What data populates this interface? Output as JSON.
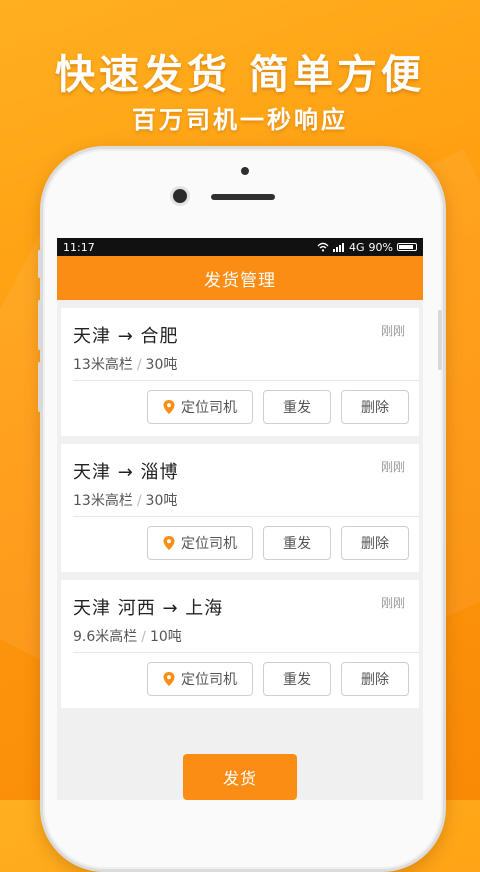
{
  "promo": {
    "headline": "快速发货 简单方便",
    "subline": "百万司机一秒响应"
  },
  "status_bar": {
    "time": "11:17",
    "network": "4G",
    "battery": "90%"
  },
  "app_bar": {
    "title": "发货管理"
  },
  "shipments": [
    {
      "route": "天津 → 合肥",
      "time": "刚刚",
      "truck": "13米高栏",
      "weight": "30吨"
    },
    {
      "route": "天津 → 淄博",
      "time": "刚刚",
      "truck": "13米高栏",
      "weight": "30吨"
    },
    {
      "route": "天津 河西 → 上海",
      "time": "刚刚",
      "truck": "9.6米高栏",
      "weight": "10吨"
    }
  ],
  "actions": {
    "locate": "定位司机",
    "resend": "重发",
    "delete": "删除",
    "separator": "/"
  },
  "primary_action": {
    "label": "发货"
  },
  "colors": {
    "accent": "#fb8c14",
    "background": "#ff9a0e"
  }
}
